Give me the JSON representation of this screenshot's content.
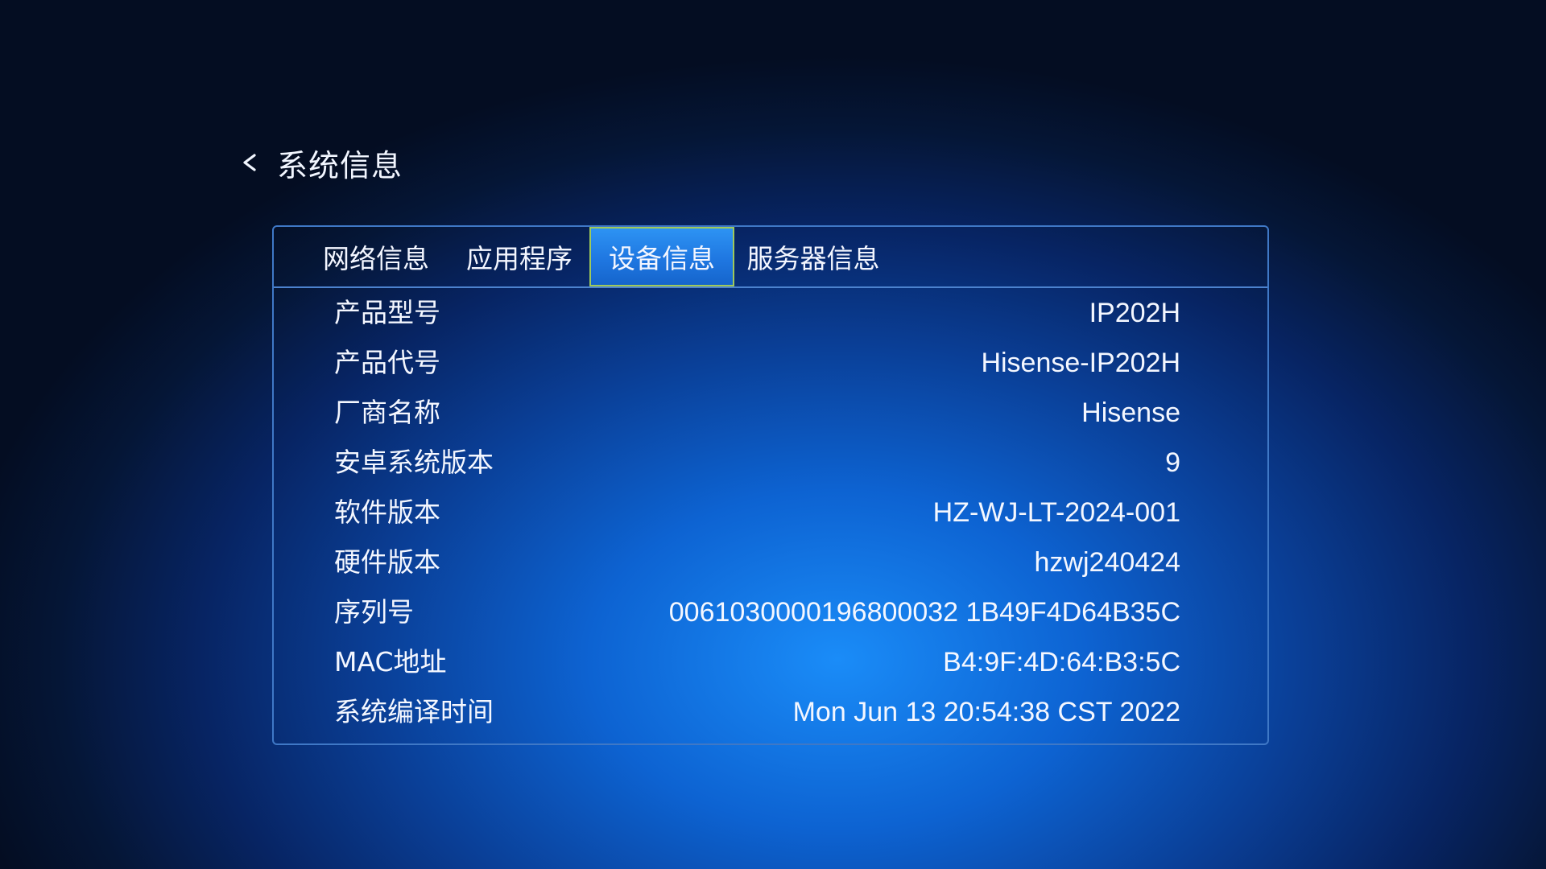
{
  "header": {
    "back_icon": "chevron-left-icon",
    "title": "系统信息"
  },
  "tabs": [
    {
      "label": "网络信息",
      "active": false
    },
    {
      "label": "应用程序",
      "active": false
    },
    {
      "label": "设备信息",
      "active": true
    },
    {
      "label": "服务器信息",
      "active": false
    }
  ],
  "device_info": [
    {
      "label": "产品型号",
      "value": "IP202H"
    },
    {
      "label": "产品代号",
      "value": "Hisense-IP202H"
    },
    {
      "label": "厂商名称",
      "value": "Hisense"
    },
    {
      "label": "安卓系统版本",
      "value": "9"
    },
    {
      "label": "软件版本",
      "value": "HZ-WJ-LT-2024-001"
    },
    {
      "label": "硬件版本",
      "value": "hzwj240424"
    },
    {
      "label": "序列号",
      "value": "0061030000196800032 1B49F4D64B35C"
    },
    {
      "label": "MAC地址",
      "value": "B4:9F:4D:64:B3:5C"
    },
    {
      "label": "系统编译时间",
      "value": "Mon Jun 13 20:54:38 CST 2022"
    }
  ],
  "colors": {
    "panel_border": "#3f78c6",
    "active_tab_border": "#9fc95a",
    "active_tab_fill": "#1f77e1"
  }
}
